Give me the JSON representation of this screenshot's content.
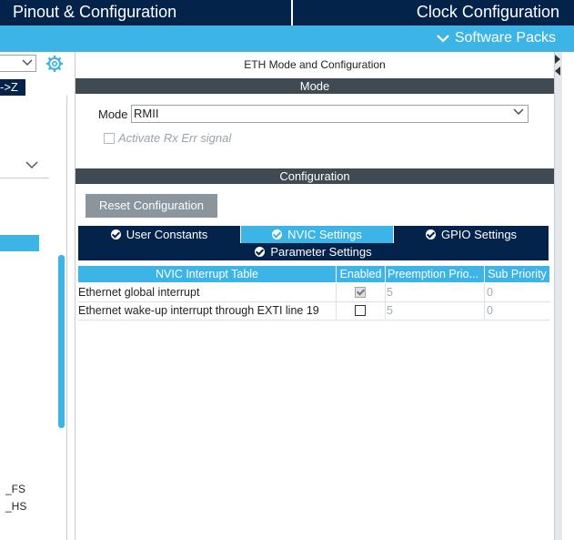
{
  "header": {
    "tab_pinout": "Pinout & Configuration",
    "tab_clock": "Clock Configuration",
    "software_packs": "Software Packs"
  },
  "left": {
    "sort_label": "->Z",
    "item_fs": "_FS",
    "item_hs": "_HS"
  },
  "main": {
    "title": "ETH Mode and Configuration",
    "mode_section": "Mode",
    "mode_label": "Mode",
    "mode_value": "RMII",
    "rx_err_label": "Activate Rx Err signal",
    "config_section": "Configuration",
    "reset_button": "Reset Configuration",
    "tabs": [
      {
        "label": "User Constants"
      },
      {
        "label": "NVIC Settings",
        "active": true
      },
      {
        "label": "GPIO Settings"
      },
      {
        "label": "Parameter Settings"
      }
    ],
    "table": {
      "columns": [
        "NVIC Interrupt Table",
        "Enabled",
        "Preemption Prio...",
        "Sub Priority"
      ],
      "rows": [
        {
          "name": "Ethernet global interrupt",
          "enabled": true,
          "preemption": "5",
          "sub": "0"
        },
        {
          "name": "Ethernet wake-up interrupt through EXTI line 19",
          "enabled": false,
          "preemption": "5",
          "sub": "0"
        }
      ]
    }
  },
  "colors": {
    "navy": "#03234b",
    "accent": "#3cb4e6",
    "section_header": "#3f4a52"
  }
}
